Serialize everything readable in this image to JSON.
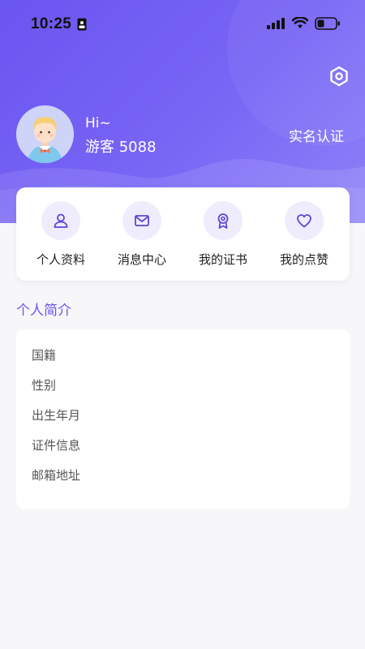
{
  "status_bar": {
    "time": "10:25",
    "icons": [
      "sim-card-icon",
      "signal-icon",
      "wifi-icon",
      "battery-icon"
    ]
  },
  "header": {
    "greeting": "Hi~",
    "username": "游客 5088",
    "verify_label": "实名认证",
    "settings_icon": "settings-icon",
    "gradient_colors": [
      "#6a55f0",
      "#8e82f8"
    ]
  },
  "quick_actions": [
    {
      "label": "个人资料",
      "icon": "user-icon"
    },
    {
      "label": "消息中心",
      "icon": "mail-icon"
    },
    {
      "label": "我的证书",
      "icon": "certificate-icon"
    },
    {
      "label": "我的点赞",
      "icon": "heart-icon"
    }
  ],
  "profile": {
    "title": "个人简介",
    "rows": [
      {
        "label": "国籍"
      },
      {
        "label": "性别"
      },
      {
        "label": "出生年月"
      },
      {
        "label": "证件信息"
      },
      {
        "label": "邮箱地址"
      }
    ]
  },
  "colors": {
    "accent": "#6a55f0",
    "icon_bg": "#efedfd",
    "page_bg": "#f7f7f9"
  }
}
